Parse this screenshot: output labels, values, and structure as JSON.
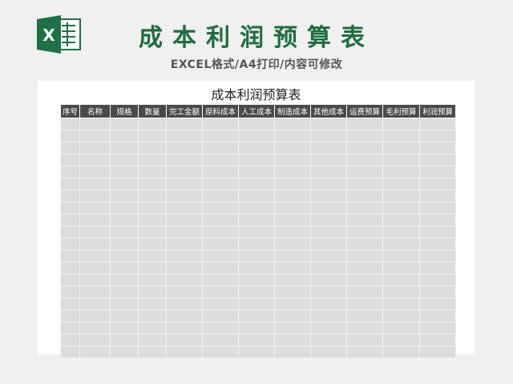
{
  "header": {
    "logo_letter": "X",
    "title": "成本利润预算表",
    "subtitle": "EXCEL格式/A4打印/内容可修改"
  },
  "sheet": {
    "title": "成本利润预算表",
    "columns": [
      "序号",
      "名称",
      "规格",
      "数量",
      "完工金额",
      "原料成本",
      "人工成本",
      "制造成本",
      "其他成本",
      "运费预算",
      "毛利预算",
      "利润预算"
    ],
    "empty_rows": 20
  },
  "colors": {
    "brand_green": "#1e6e3f",
    "header_fill": "#4a4a4a",
    "cell_fill": "#dcdcdc"
  }
}
